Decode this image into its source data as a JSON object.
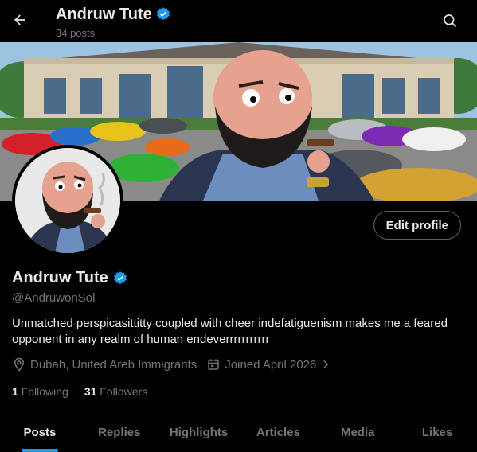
{
  "header": {
    "name": "Andruw Tute",
    "post_count": "34 posts"
  },
  "profile": {
    "display_name": "Andruw Tute",
    "handle": "@AndruwonSol",
    "bio": "Unmatched perspicasittitty  coupled with cheer indefatiguenism makes me a feared opponent in any realm of human endeverrrrrrrrrrr",
    "location": "Dubah, United Areb Immigrants",
    "joined": "Joined April 2026",
    "following_count": "1",
    "following_label": "Following",
    "followers_count": "31",
    "followers_label": "Followers",
    "edit_label": "Edit profile"
  },
  "tabs": [
    {
      "label": "Posts",
      "active": true
    },
    {
      "label": "Replies"
    },
    {
      "label": "Highlights"
    },
    {
      "label": "Articles"
    },
    {
      "label": "Media"
    },
    {
      "label": "Likes"
    }
  ],
  "colors": {
    "accent": "#1d9bf0",
    "muted": "#71767b",
    "text": "#e7e9ea",
    "background": "#000000"
  },
  "icons": [
    "back-arrow-icon",
    "verified-badge-icon",
    "search-icon",
    "location-icon",
    "calendar-icon",
    "chevron-right-icon"
  ]
}
